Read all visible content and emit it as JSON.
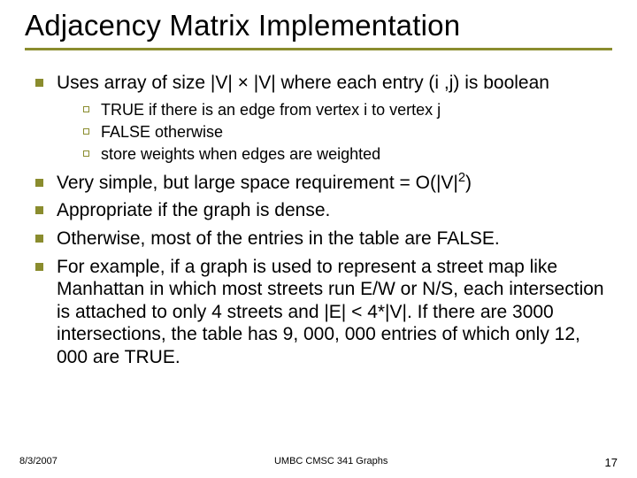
{
  "title": "Adjacency Matrix Implementation",
  "bullets": {
    "b1": "Uses array of size |V| × |V| where each entry (i ,j) is boolean",
    "b1_sub": {
      "s1": "TRUE if there is an edge from vertex i to vertex j",
      "s2": "FALSE otherwise",
      "s3": "store weights when edges are weighted"
    },
    "b2_pre": "Very simple, but large space requirement = O(|V|",
    "b2_sup": "2",
    "b2_post": ")",
    "b3": "Appropriate if the graph is dense.",
    "b4": "Otherwise, most of the entries in the table are FALSE.",
    "b5": "For example, if  a graph is used to represent a street map like Manhattan in which most streets run E/W or N/S, each intersection is attached to only 4 streets and |E|  < 4*|V|.  If there are 3000 intersections, the table has 9, 000, 000 entries of which only 12, 000 are TRUE."
  },
  "footer": {
    "date": "8/3/2007",
    "center": "UMBC CMSC 341 Graphs",
    "pagenum": "17"
  }
}
